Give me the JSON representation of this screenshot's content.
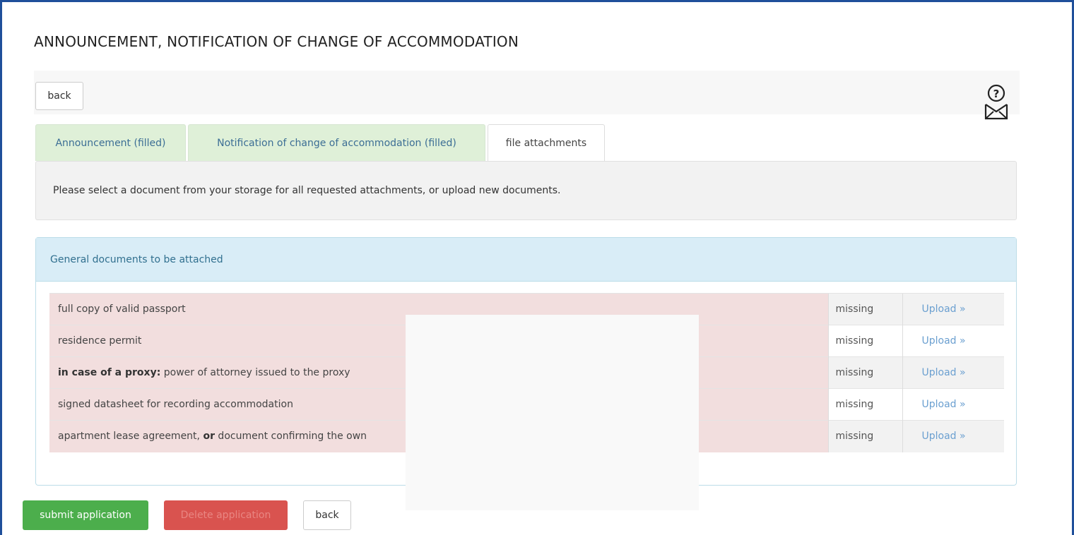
{
  "page": {
    "title": "ANNOUNCEMENT, NOTIFICATION OF CHANGE OF ACCOMMODATION"
  },
  "toolbar": {
    "back_label": "back",
    "help_icon": "envelope-question-icon"
  },
  "tabs": [
    {
      "label": "Announcement (filled)",
      "state": "filled"
    },
    {
      "label": "Notification of change of accommodation (filled)",
      "state": "filled"
    },
    {
      "label": "file attachments",
      "state": "active"
    }
  ],
  "info": {
    "text": "Please select a document from your storage for all requested attachments, or upload new documents."
  },
  "attachments": {
    "heading": "General documents to be attached",
    "rows": [
      {
        "prefix": "",
        "name": "full copy of valid passport",
        "status": "missing",
        "action": "Upload »"
      },
      {
        "prefix": "",
        "name": "residence permit",
        "status": "missing",
        "action": "Upload »"
      },
      {
        "prefix": "in case of a proxy:",
        "name": " power of attorney issued to the proxy",
        "status": "missing",
        "action": "Upload »"
      },
      {
        "prefix": "",
        "name": "signed datasheet for recording accommodation",
        "status": "missing",
        "action": "Upload »"
      },
      {
        "name_part1": "apartment lease agreement, ",
        "name_bold": "or",
        "name_part2": " document confirming the own",
        "status": "missing",
        "action": "Upload »"
      }
    ]
  },
  "actions": {
    "submit_label": "submit application",
    "delete_label": "Delete application",
    "back_label": "back"
  },
  "colors": {
    "frame": "#1f4f9a",
    "tab_filled_bg": "#dff0d8",
    "panel_head_bg": "#d9edf7",
    "missing_row_bg": "#f2dede",
    "submit_bg": "#4cae4c",
    "delete_bg": "#d9534f",
    "link": "#6a9fd0"
  }
}
